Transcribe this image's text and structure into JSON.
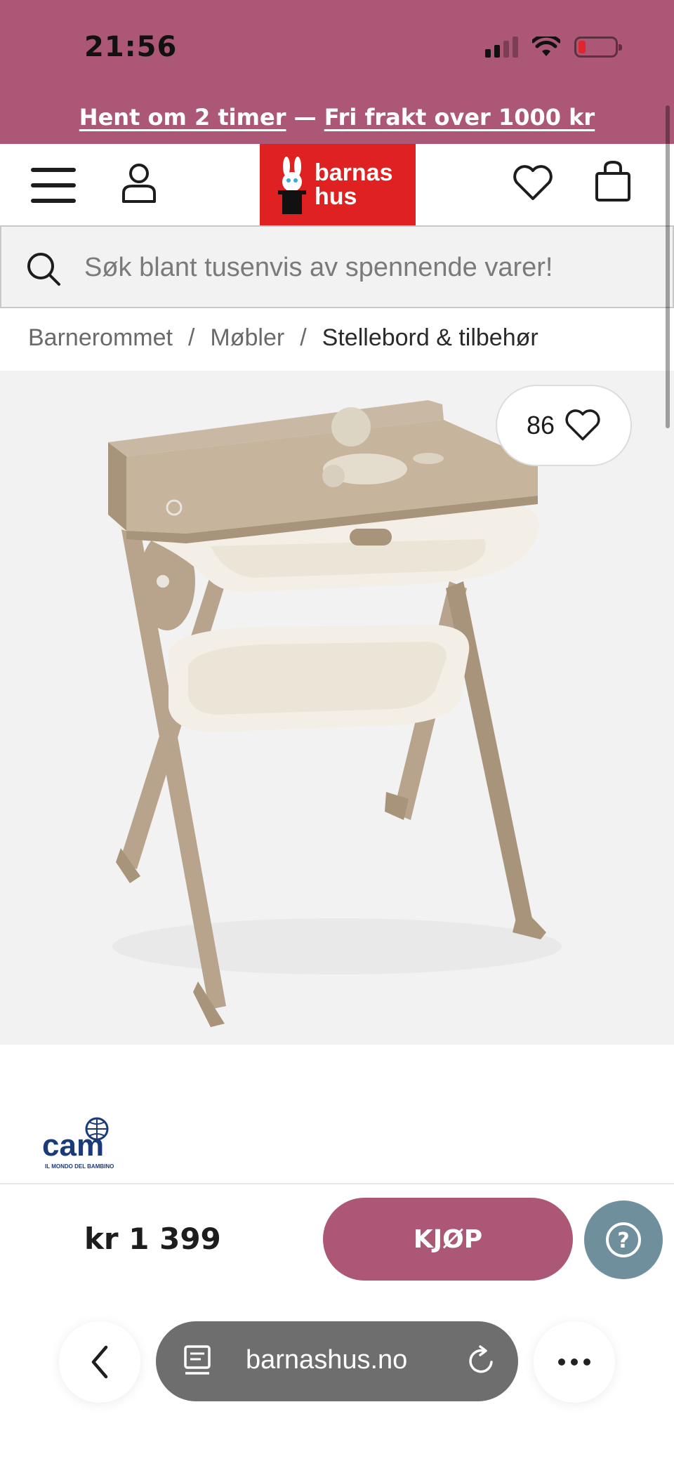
{
  "status_bar": {
    "time": "21:56"
  },
  "promo": {
    "part1": "Hent om 2 timer",
    "separator": "—",
    "part2": "Fri frakt over 1000 kr"
  },
  "header": {
    "logo_line1": "barnas",
    "logo_line2": "hus"
  },
  "search": {
    "placeholder": "Søk blant tusenvis av spennende varer!"
  },
  "breadcrumb": {
    "items": [
      "Barnerommet",
      "Møbler",
      "Stellebord & tilbehør"
    ],
    "separator": "/"
  },
  "product": {
    "favorite_count": "86",
    "brand_name": "cam",
    "brand_tagline": "IL MONDO DEL BAMBINO",
    "price": "kr 1 399"
  },
  "buy_bar": {
    "buy_label": "KJØP",
    "help_label": "?"
  },
  "browser": {
    "url": "barnashus.no"
  },
  "colors": {
    "brand_pink": "#ab5775",
    "logo_red": "#e02121",
    "help_blue": "#6f8f9c"
  },
  "icons": [
    "menu-icon",
    "user-icon",
    "heart-icon",
    "bag-icon",
    "search-icon",
    "chevron-left-icon",
    "page-icon",
    "reload-icon",
    "more-icon",
    "help-icon"
  ]
}
